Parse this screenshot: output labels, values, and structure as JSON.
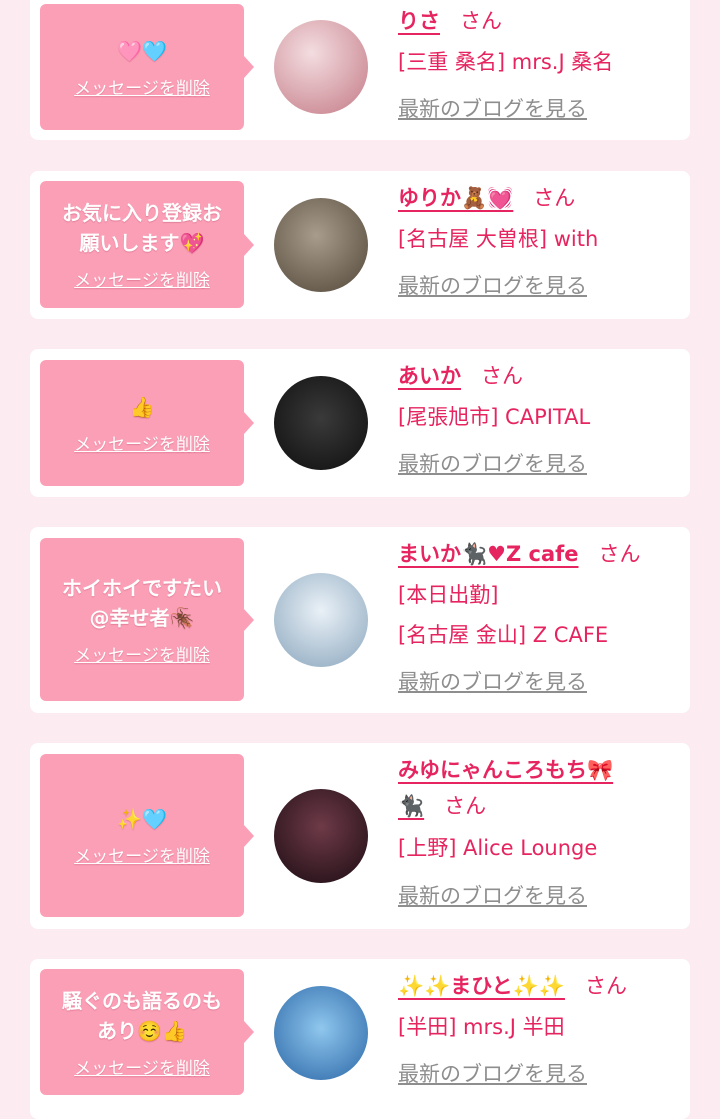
{
  "common": {
    "delete_label": "メッセージを削除",
    "san": "さん",
    "blog_link": "最新のブログを見る"
  },
  "cards": [
    {
      "message": "🩷🩵",
      "name": "りさ",
      "shops": [
        "[三重 桑名] mrs.J 桑名"
      ],
      "avatar_colors": [
        "#f3dde0",
        "#c47a86"
      ]
    },
    {
      "message": "お気に入り登録お\n願いします💖",
      "name": "ゆりか🧸💓",
      "shops": [
        "[名古屋 大曽根] with"
      ],
      "avatar_colors": [
        "#a89c8c",
        "#524638"
      ]
    },
    {
      "message": "👍",
      "name": "あいか",
      "shops": [
        "[尾張旭市] CAPITAL"
      ],
      "avatar_colors": [
        "#3a3a3a",
        "#0e0e0e"
      ]
    },
    {
      "message": "ホイホイですたい\n@幸せ者🪳",
      "name": "まいか🐈‍⬛♥Z cafe",
      "shops": [
        "[本日出勤]",
        "[名古屋 金山] Z CAFE"
      ],
      "avatar_colors": [
        "#eaf1f7",
        "#8aa6bd"
      ]
    },
    {
      "message": "✨🩵",
      "name": "みゆにゃんころもち🎀",
      "name_cont": "🐈‍⬛",
      "shops": [
        "[上野] Alice Lounge"
      ],
      "avatar_colors": [
        "#6e3a48",
        "#1c0c12"
      ]
    },
    {
      "message": "騒ぐのも語るのも\nあり☺️👍",
      "name": "✨✨まひと✨✨",
      "shops": [
        "[半田] mrs.J 半田"
      ],
      "avatar_colors": [
        "#8fc7ee",
        "#2a66a6"
      ]
    }
  ]
}
